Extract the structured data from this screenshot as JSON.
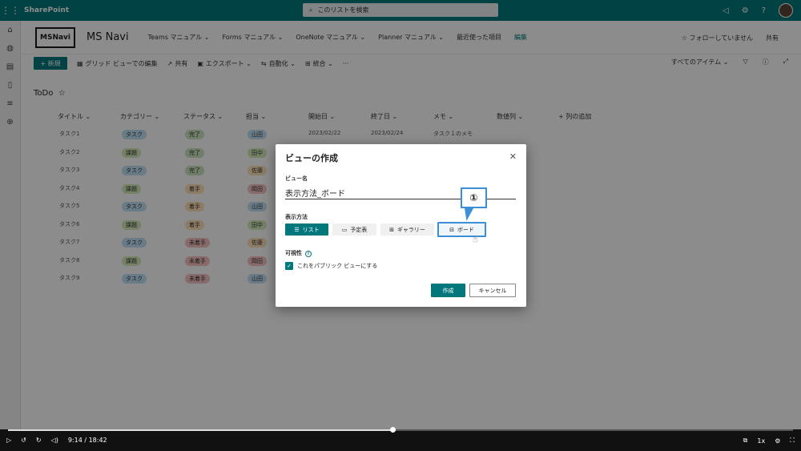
{
  "suite": {
    "app_name": "SharePoint",
    "search_placeholder": "このリストを検索"
  },
  "site": {
    "logo_text": "MSNavi",
    "title": "MS Navi",
    "nav": [
      "Teams マニュアル ⌄",
      "Forms マニュアル ⌄",
      "OneNote マニュアル ⌄",
      "Planner マニュアル ⌄",
      "最近使った項目"
    ],
    "edit_label": "編集",
    "follow_label": "☆ フォローしていません",
    "share_label": "共有"
  },
  "command_bar": {
    "new_label": "新規",
    "items": [
      "グリッド ビューでの編集",
      "共有",
      "エクスポート ⌄",
      "自動化 ⌄",
      "統合 ⌄",
      "···"
    ],
    "view_selector": "すべてのアイテム ⌄"
  },
  "list": {
    "title": "ToDo",
    "headers": [
      "タイトル ⌄",
      "カテゴリー ⌄",
      "ステータス ⌄",
      "担当 ⌄",
      "開始日 ⌄",
      "終了日 ⌄",
      "メモ ⌄",
      "数値列 ⌄",
      "+ 列の追加"
    ],
    "rows": [
      {
        "title": "タスク1",
        "category": "タスク",
        "status": "完了",
        "assignee": "山田",
        "start": "2023/02/22",
        "end": "2023/02/24",
        "memo": "タスク１のメモ"
      },
      {
        "title": "タスク2",
        "category": "課題",
        "status": "完了",
        "assignee": "田中",
        "start": "",
        "end": "",
        "memo": ""
      },
      {
        "title": "タスク3",
        "category": "タスク",
        "status": "完了",
        "assignee": "佐藤",
        "start": "",
        "end": "",
        "memo": ""
      },
      {
        "title": "タスク4",
        "category": "課題",
        "status": "着手",
        "assignee": "岡田",
        "start": "",
        "end": "",
        "memo": ""
      },
      {
        "title": "タスク5",
        "category": "タスク",
        "status": "着手",
        "assignee": "山田",
        "start": "",
        "end": "",
        "memo": ""
      },
      {
        "title": "タスク6",
        "category": "課題",
        "status": "着手",
        "assignee": "田中",
        "start": "",
        "end": "",
        "memo": ""
      },
      {
        "title": "タスク7",
        "category": "タスク",
        "status": "未着手",
        "assignee": "佐藤",
        "start": "",
        "end": "",
        "memo": ""
      },
      {
        "title": "タスク8",
        "category": "課題",
        "status": "未着手",
        "assignee": "岡田",
        "start": "",
        "end": "",
        "memo": ""
      },
      {
        "title": "タスク9",
        "category": "タスク",
        "status": "未着手",
        "assignee": "山田",
        "start": "",
        "end": "",
        "memo": ""
      }
    ]
  },
  "dialog": {
    "title": "ビューの作成",
    "name_label": "ビュー名",
    "name_value": "表示方法_ボード",
    "display_label": "表示方法",
    "view_types": [
      "リスト",
      "予定表",
      "ギャラリー",
      "ボード"
    ],
    "visibility_label": "可視性",
    "public_checkbox_label": "これをパブリック ビューにする",
    "create_label": "作成",
    "cancel_label": "キャンセル"
  },
  "callout": {
    "text": "①"
  },
  "video": {
    "time": "9:14 / 18:42",
    "speed": "1x",
    "progress": 0.49
  },
  "colors": {
    "accent": "#03787c",
    "callout": "#3a8fd6"
  }
}
